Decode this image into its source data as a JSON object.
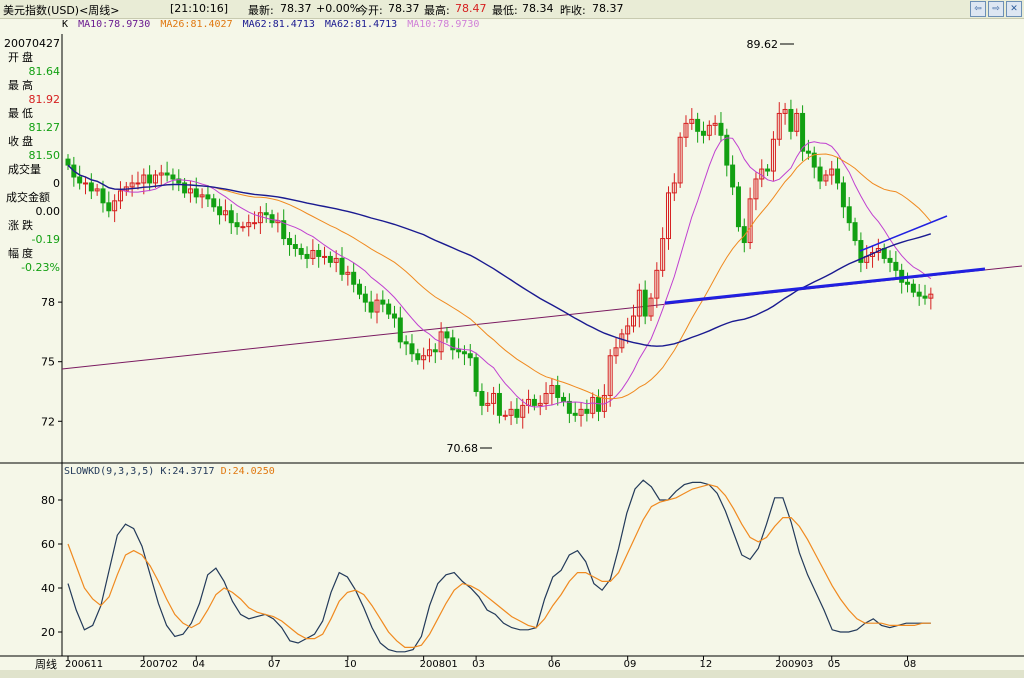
{
  "topbar": {
    "title": "美元指数(USD)<周线>",
    "time": "[21:10:16]",
    "latest_label": "最新:",
    "latest": "78.37",
    "change": "+0.00%",
    "open_label": "今开:",
    "open": "78.37",
    "high_label": "最高:",
    "high": "78.47",
    "low_label": "最低:",
    "low": "78.34",
    "prev_label": "昨收:",
    "prev": "78.37"
  },
  "ma_legend": {
    "k": "K",
    "ma10": "MA10:78.9730",
    "ma26": "MA26:81.4027",
    "ma62a": "MA62:81.4713",
    "ma62b": "MA62:81.4713",
    "ma10b": "MA10:78.9730"
  },
  "left_panel": {
    "date": "20070427",
    "open_label": "开盘",
    "open": "81.64",
    "high_label": "最高",
    "high": "81.92",
    "low_label": "最低",
    "low": "81.27",
    "close_label": "收盘",
    "close": "81.50",
    "vol_label": "成交量",
    "vol": "0",
    "amount_label": "成交金额",
    "amount": "0.00",
    "change_label": "涨跌",
    "change": "-0.19",
    "amp_label": "幅度",
    "amp": "-0.23%"
  },
  "kd_legend": {
    "name": "SLOWKD(9,3,3,5)",
    "k": "K:24.3717",
    "d": "D:24.0250"
  },
  "xaxis_label": "周线",
  "colors": {
    "up": "#d62020",
    "down": "#12a012",
    "ma10": "#c040d0",
    "ma26": "#f08a20",
    "ma62": "#1a1a90",
    "trend": "#2020e0",
    "long_trend": "#7a1a60",
    "kd_k": "#233a5a",
    "kd_d": "#f08a20"
  },
  "chart_data": [
    {
      "type": "candlestick",
      "ylim": [
        70,
        91.5
      ],
      "yticks": [
        72,
        75,
        78
      ],
      "max_annotation": "89.62",
      "min_annotation": "70.68",
      "x_labels": [
        "200611",
        "200702",
        "04",
        "07",
        "10",
        "200801",
        "03",
        "06",
        "09",
        "12",
        "200903",
        "05",
        "08"
      ],
      "x_label_index": [
        0,
        13,
        22,
        35,
        48,
        61,
        70,
        83,
        96,
        109,
        122,
        131,
        144
      ],
      "closes": [
        84.9,
        84.3,
        84.0,
        84.0,
        83.6,
        83.7,
        83.0,
        82.6,
        83.1,
        83.6,
        83.8,
        84.0,
        84.0,
        84.4,
        84.0,
        84.4,
        84.5,
        84.4,
        84.2,
        84.0,
        83.5,
        83.7,
        83.3,
        83.4,
        83.2,
        82.8,
        82.4,
        82.6,
        82.0,
        81.8,
        81.8,
        82.0,
        82.0,
        82.5,
        82.4,
        82.0,
        82.1,
        81.2,
        80.9,
        80.7,
        80.4,
        80.2,
        80.6,
        80.3,
        80.3,
        80.0,
        80.2,
        79.4,
        79.5,
        78.9,
        78.4,
        78.0,
        77.5,
        78.1,
        77.9,
        77.4,
        77.2,
        76.0,
        75.9,
        75.4,
        75.1,
        75.3,
        75.6,
        75.5,
        76.5,
        76.2,
        75.6,
        75.5,
        75.4,
        75.2,
        73.5,
        72.8,
        72.9,
        73.4,
        72.3,
        72.3,
        72.6,
        72.2,
        72.8,
        73.1,
        72.8,
        72.9,
        73.4,
        73.8,
        73.2,
        73.0,
        72.4,
        72.3,
        72.6,
        72.4,
        73.2,
        72.5,
        73.3,
        75.3,
        75.7,
        76.4,
        76.8,
        77.3,
        78.6,
        77.3,
        78.2,
        79.6,
        81.2,
        83.5,
        84.0,
        86.3,
        87.0,
        87.2,
        86.6,
        86.4,
        86.9,
        87.0,
        86.4,
        84.9,
        83.8,
        81.8,
        81.0,
        83.2,
        84.2,
        84.7,
        84.6,
        86.2,
        87.5,
        87.7,
        86.6,
        87.5,
        85.6,
        85.5,
        84.8,
        84.1,
        84.4,
        84.7,
        84.0,
        82.8,
        82.0,
        81.1,
        80.0,
        80.3,
        80.5,
        80.7,
        80.2,
        80.0,
        79.6,
        79.0,
        78.9,
        78.5,
        78.3,
        78.2,
        78.4
      ]
    },
    {
      "type": "line",
      "title": "SLOWKD(9,3,3,5)",
      "ylim": [
        10,
        90
      ],
      "yticks": [
        20,
        40,
        60,
        80
      ],
      "series": [
        {
          "name": "K",
          "values": [
            42,
            30,
            21,
            23,
            32,
            48,
            64,
            69,
            67,
            59,
            46,
            33,
            23,
            18,
            19,
            24,
            33,
            46,
            49,
            43,
            34,
            28,
            26,
            27,
            28,
            26,
            22,
            16,
            15,
            17,
            19,
            25,
            38,
            47,
            45,
            39,
            31,
            22,
            15,
            12,
            11,
            11,
            12,
            18,
            32,
            42,
            46,
            47,
            43,
            40,
            36,
            30,
            28,
            24,
            22,
            21,
            21,
            22,
            35,
            45,
            48,
            55,
            57,
            52,
            42,
            39,
            44,
            58,
            74,
            85,
            89,
            86,
            80,
            80,
            84,
            87,
            88,
            88,
            87,
            83,
            75,
            65,
            55,
            53,
            58,
            69,
            81,
            81,
            70,
            56,
            46,
            38,
            30,
            21,
            20,
            20,
            21,
            24,
            26,
            23,
            22,
            23,
            24,
            24,
            24,
            24
          ]
        },
        {
          "name": "D",
          "values": [
            60,
            50,
            40,
            35,
            32,
            36,
            46,
            55,
            57,
            55,
            50,
            43,
            35,
            28,
            24,
            22,
            24,
            30,
            37,
            40,
            38,
            35,
            31,
            29,
            28,
            27,
            25,
            22,
            19,
            17,
            17,
            19,
            26,
            34,
            38,
            39,
            37,
            32,
            26,
            20,
            16,
            13,
            13,
            14,
            19,
            26,
            33,
            39,
            42,
            41,
            39,
            36,
            33,
            30,
            27,
            25,
            23,
            22,
            26,
            32,
            37,
            43,
            47,
            47,
            45,
            43,
            43,
            47,
            55,
            63,
            71,
            77,
            79,
            80,
            81,
            83,
            85,
            86,
            87,
            86,
            82,
            76,
            69,
            63,
            61,
            63,
            68,
            72,
            72,
            68,
            62,
            55,
            48,
            41,
            35,
            30,
            26,
            24,
            24,
            24,
            23,
            23,
            23,
            23,
            24,
            24
          ]
        }
      ]
    }
  ]
}
